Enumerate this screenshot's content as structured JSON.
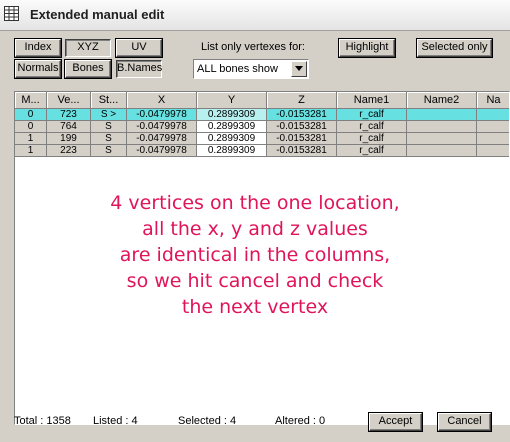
{
  "window": {
    "title": "Extended manual edit"
  },
  "toolbar": {
    "index": "Index",
    "xyz": "XYZ",
    "uv": "UV",
    "normals": "Normals",
    "bones": "Bones",
    "bnames": "B.Names",
    "filter_label": "List only vertexes for:",
    "filter_value": "ALL bones show",
    "highlight": "Highlight",
    "selected_only": "Selected only"
  },
  "table": {
    "columns": [
      "M...",
      "Ve...",
      "St...",
      "X",
      "Y",
      "Z",
      "Name1",
      "Name2",
      "Na"
    ],
    "rows": [
      [
        "0",
        "723",
        "S >",
        "-0.0479978",
        "0.2899309",
        "-0.0153281",
        "r_calf",
        "",
        ""
      ],
      [
        "0",
        "764",
        "S",
        "-0.0479978",
        "0.2899309",
        "-0.0153281",
        "r_calf",
        "",
        ""
      ],
      [
        "1",
        "199",
        "S",
        "-0.0479978",
        "0.2899309",
        "-0.0153281",
        "r_calf",
        "",
        ""
      ],
      [
        "1",
        "223",
        "S",
        "-0.0479978",
        "0.2899309",
        "-0.0153281",
        "r_calf",
        "",
        ""
      ]
    ]
  },
  "annotation": {
    "lines": [
      "4 vertices on the one location,",
      "all the x, y and z values",
      "are identical in the columns,",
      "so we hit cancel and check",
      "the next vertex"
    ]
  },
  "status": {
    "total": "Total : 1358",
    "listed": "Listed : 4",
    "selected": "Selected : 4",
    "altered": "Altered : 0",
    "accept": "Accept",
    "cancel": "Cancel"
  },
  "colors": {
    "selected_row": "#66e0e0",
    "annotation": "#e0145a"
  }
}
